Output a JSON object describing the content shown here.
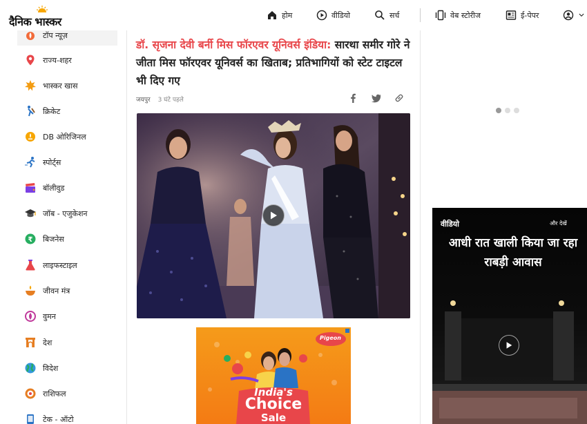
{
  "brand": {
    "logo_text": "दैनिक भास्कर"
  },
  "nav": {
    "home": "होम",
    "video": "वीडियो",
    "search": "सर्च",
    "web_stories": "वेब स्टोरीज",
    "epaper": "ई-पेपर"
  },
  "sidebar": {
    "items": [
      {
        "label": "टॉप न्यूज़",
        "icon": "top-news-icon",
        "color": "#e8464a"
      },
      {
        "label": "राज्य-शहर",
        "icon": "location-pin-icon",
        "color": "#e8464a"
      },
      {
        "label": "भास्कर खास",
        "icon": "sun-icon",
        "color": "#f39c12"
      },
      {
        "label": "क्रिकेट",
        "icon": "cricket-icon",
        "color": "#2a73c5"
      },
      {
        "label": "DB ओरिजिनल",
        "icon": "db-original-icon",
        "color": "#f39c12"
      },
      {
        "label": "स्पोर्ट्स",
        "icon": "sports-icon",
        "color": "#2a73c5"
      },
      {
        "label": "बॉलीवुड",
        "icon": "clapper-icon",
        "color": "#7b3fe4"
      },
      {
        "label": "जॉब - एजुकेशन",
        "icon": "graduation-cap-icon",
        "color": "#333"
      },
      {
        "label": "बिजनेस",
        "icon": "rupee-icon",
        "color": "#27ae60"
      },
      {
        "label": "लाइफस्टाइल",
        "icon": "flask-icon",
        "color": "#e8464a"
      },
      {
        "label": "जीवन मंत्र",
        "icon": "diya-icon",
        "color": "#e67e22"
      },
      {
        "label": "वुमन",
        "icon": "women-icon",
        "color": "#c0399b"
      },
      {
        "label": "देश",
        "icon": "gate-icon",
        "color": "#e67e22"
      },
      {
        "label": "विदेश",
        "icon": "globe-icon",
        "color": "#27ae60"
      },
      {
        "label": "राशिफल",
        "icon": "zodiac-icon",
        "color": "#e67e22"
      },
      {
        "label": "टेक - ऑटो",
        "icon": "tech-icon",
        "color": "#2a73c5"
      }
    ]
  },
  "article": {
    "headline_highlight": "डॉ. सृजना देवी बर्नी मिस फॉरएवर यूनिवर्स इंडिया:",
    "headline_rest": " सारथा समीर गोरे ने जीता मिस फॉरएवर यूनिवर्स का खिताब; प्रतिभागियों को स्टेट टाइटल भी दिए गए",
    "location": "जयपुर",
    "time": "3 घंटे पहले"
  },
  "ad": {
    "brand": "Pigeon",
    "line1": "India's",
    "line2": "Choice",
    "line3": "Sale"
  },
  "video_widget": {
    "heading": "वीडियो",
    "more": "और देखें",
    "title": "आधी रात खाली किया जा रहा राबड़ी आवास"
  },
  "colors": {
    "accent": "#e8464a",
    "brand_orange": "#f7a600"
  }
}
